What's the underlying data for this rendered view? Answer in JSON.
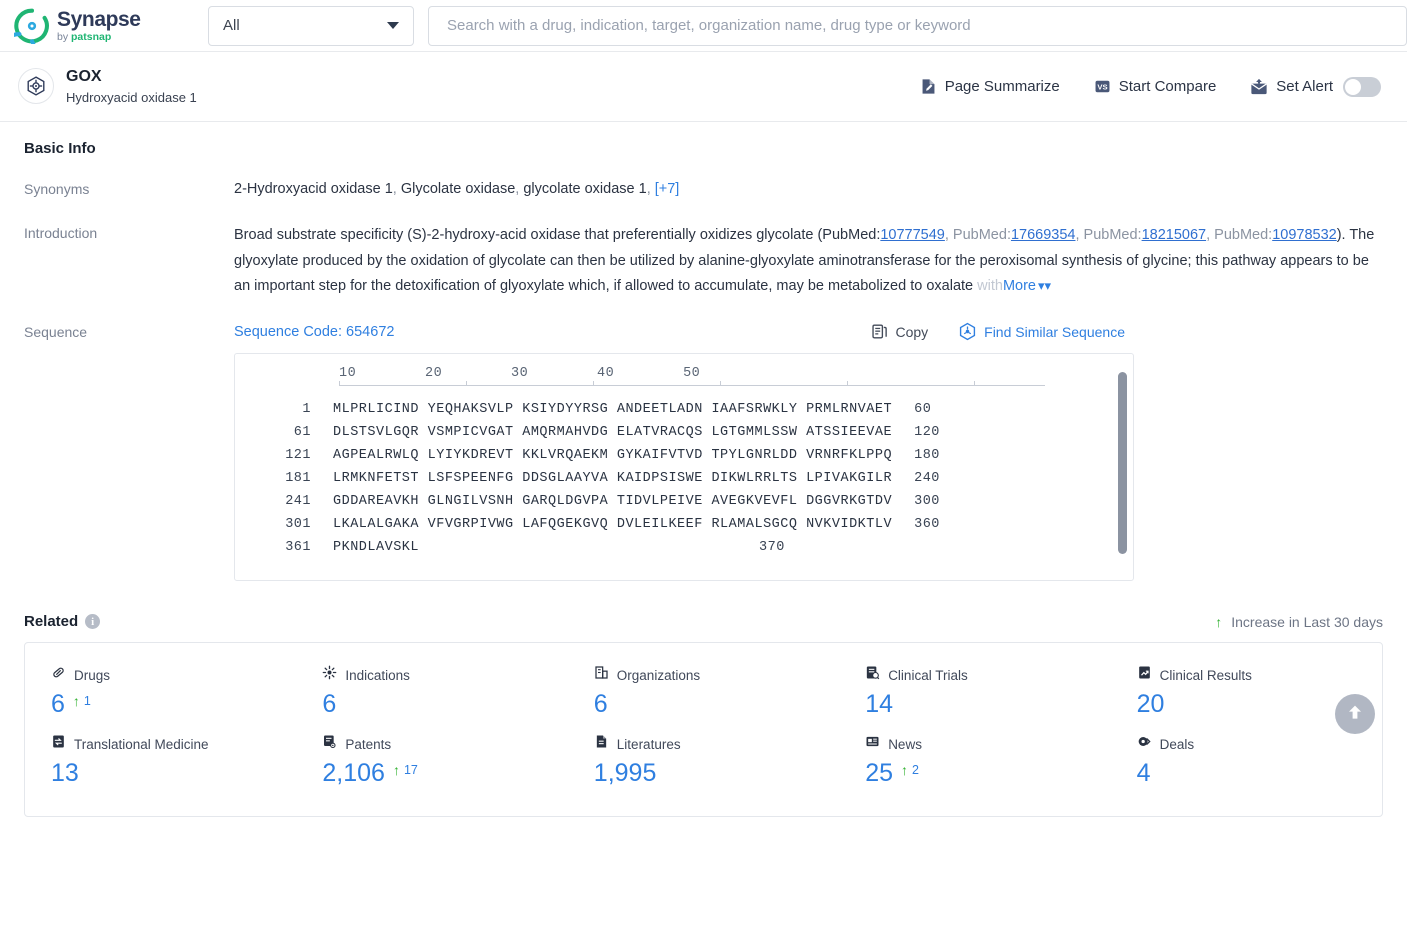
{
  "brand": {
    "name": "Synapse",
    "by": "by ",
    "by_brand": "patsnap",
    "logo_icon": "synapse-logo-icon"
  },
  "search": {
    "scope_value": "All",
    "placeholder": "Search with a drug, indication, target, organization name, drug type or keyword",
    "value": "",
    "caret_icon": "chevron-down-icon"
  },
  "entity": {
    "icon": "target-protein-icon",
    "name": "GOX",
    "description": "Hydroxyacid oxidase 1",
    "actions": [
      {
        "label": "Page Summarize",
        "icon": "page-summarize-icon"
      },
      {
        "label": "Start Compare",
        "icon": "vs-compare-icon"
      },
      {
        "label": "Set Alert",
        "icon": "alert-mail-icon"
      }
    ],
    "alert_toggle_state": "off"
  },
  "basic_info": {
    "title": "Basic Info",
    "synonyms": {
      "label": "Synonyms",
      "items": [
        "2-Hydroxyacid oxidase 1",
        "Glycolate oxidase",
        "glycolate oxidase 1"
      ],
      "more_label": "[+7]"
    },
    "introduction": {
      "label": "Introduction",
      "text_1": "Broad substrate specificity (S)-2-hydroxy-acid oxidase that preferentially oxidizes glycolate (PubMed:",
      "link_1": "10777549",
      "text_2": ", PubMed:",
      "link_2": "17669354",
      "text_3": ", PubMed:",
      "link_3": "18215067",
      "text_4": ", PubMed:",
      "link_4": "10978532",
      "text_5": "). The glyoxylate produced by the oxidation of glycolate can then be utilized by alanine-glyoxylate aminotransferase for the peroxisomal synthesis of glycine; this pathway appears to be an important step for the detoxification of glyoxylate which, if allowed to accumulate, may be metabolized to oxalate",
      "text_tail": " with",
      "more_label": "More",
      "more_icon": "chevron-double-down-icon"
    }
  },
  "sequence": {
    "label": "Sequence",
    "code_label": "Sequence Code: 654672",
    "tools": [
      {
        "label": "Copy",
        "icon": "copy-icon"
      },
      {
        "label": "Find Similar Sequence",
        "icon": "find-similar-sequence-icon"
      }
    ],
    "ruler_ticks": [
      "10",
      "20",
      "30",
      "40",
      "50"
    ],
    "rows": [
      {
        "start": "1",
        "chunks": "MLPRLICIND YEQHAKSVLP KSIYDYYRSG ANDEETLADN IAAFSRWKLY PRMLRNVAET",
        "end": "60"
      },
      {
        "start": "61",
        "chunks": "DLSTSVLGQR VSMPICVGAT AMQRMAHVDG ELATVRACQS LGTGMMLSSW ATSSIEEVAE",
        "end": "120"
      },
      {
        "start": "121",
        "chunks": "AGPEALRWLQ LYIYKDREVT KKLVRQAEKM GYKAIFVTVD TPYLGNRLDD VRNRFKLPPQ",
        "end": "180"
      },
      {
        "start": "181",
        "chunks": "LRMKNFETST LSFSPEENFG DDSGLAAYVA KAIDPSISWE DIKWLRRLTS LPIVAKGILR",
        "end": "240"
      },
      {
        "start": "241",
        "chunks": "GDDAREAVKH GLNGILVSNH GARQLDGVPA TIDVLPEIVE AVEGKVEVFL DGGVRKGTDV",
        "end": "300"
      },
      {
        "start": "301",
        "chunks": "LKALALGAKA VFVGRPIVWG LAFQGEKGVQ DVLEILKEEF RLAMALSGCQ NVKVIDKTLV",
        "end": "360"
      },
      {
        "start": "361",
        "chunks": "PKNDLAVSKL",
        "end": "370"
      }
    ]
  },
  "related": {
    "title": "Related",
    "info_icon": "info-icon",
    "legend": {
      "icon": "arrow-up-icon",
      "label": "Increase in Last 30 days"
    },
    "stats": [
      {
        "label": "Drugs",
        "icon": "drugs-icon",
        "value": "6",
        "delta": "1"
      },
      {
        "label": "Indications",
        "icon": "indications-icon",
        "value": "6",
        "delta": ""
      },
      {
        "label": "Organizations",
        "icon": "organizations-icon",
        "value": "6",
        "delta": ""
      },
      {
        "label": "Clinical Trials",
        "icon": "clinical-trials-icon",
        "value": "14",
        "delta": ""
      },
      {
        "label": "Clinical Results",
        "icon": "clinical-results-icon",
        "value": "20",
        "delta": ""
      },
      {
        "label": "Translational Medicine",
        "icon": "translational-medicine-icon",
        "value": "13",
        "delta": ""
      },
      {
        "label": "Patents",
        "icon": "patents-icon",
        "value": "2,106",
        "delta": "17"
      },
      {
        "label": "Literatures",
        "icon": "literatures-icon",
        "value": "1,995",
        "delta": ""
      },
      {
        "label": "News",
        "icon": "news-icon",
        "value": "25",
        "delta": "2"
      },
      {
        "label": "Deals",
        "icon": "deals-icon",
        "value": "4",
        "delta": ""
      }
    ]
  },
  "scroll_top": {
    "icon": "arrow-up-circle-icon"
  },
  "colors": {
    "accent": "#2f7fe0",
    "increase": "#34b233",
    "brand_green": "#1fb573",
    "brand_dark": "#2e3a59"
  }
}
